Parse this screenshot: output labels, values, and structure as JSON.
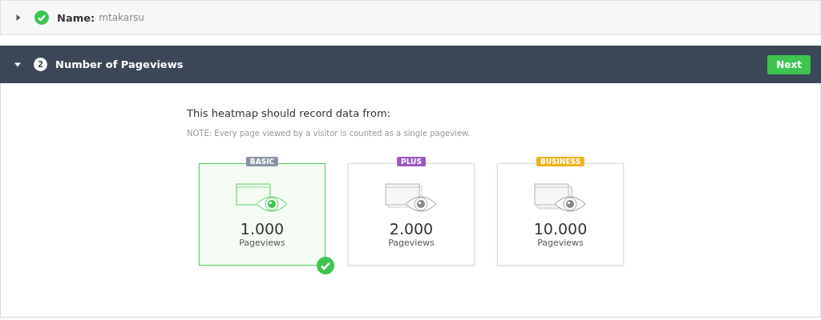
{
  "steps": [
    {
      "label": "Name:",
      "value": "mtakarsu",
      "expanded": false,
      "complete": true
    },
    {
      "number": "2",
      "label": "Number of Pageviews",
      "expanded": true,
      "complete": false,
      "button": "Next",
      "heading": "This heatmap should record data from:",
      "note": "NOTE: Every page viewed by a visitor is counted as a single pageview.",
      "plans": [
        {
          "badge": "BASIC",
          "color": "#8a93a2",
          "count": "1.000",
          "unit": "Pageviews",
          "selected": true
        },
        {
          "badge": "PLUS",
          "color": "#9b59c4",
          "count": "2.000",
          "unit": "Pageviews",
          "selected": false
        },
        {
          "badge": "BUSINESS",
          "color": "#f0b01c",
          "count": "10.000",
          "unit": "Pageviews",
          "selected": false
        }
      ]
    }
  ]
}
